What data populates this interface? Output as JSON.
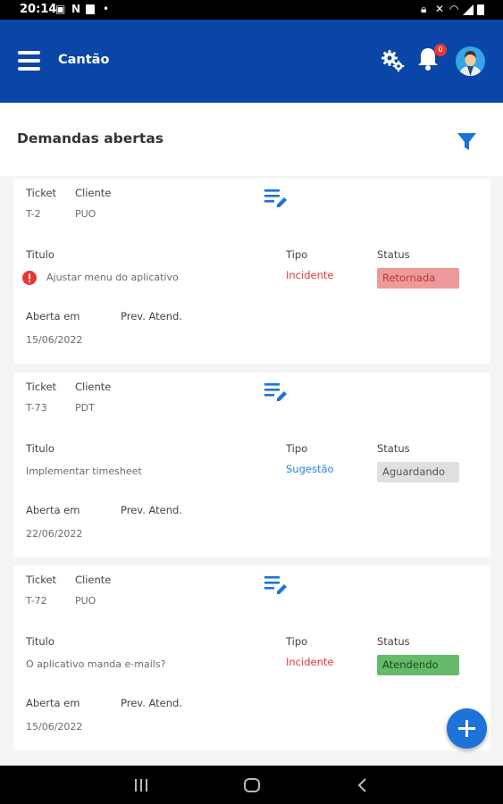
{
  "status_bar": {
    "time": "20:14",
    "n_glyph": "N"
  },
  "app_bar": {
    "title": "Cantão",
    "notification_count": "0"
  },
  "section": {
    "title": "Demandas abertas"
  },
  "labels": {
    "ticket": "Ticket",
    "cliente": "Cliente",
    "titulo": "Titulo",
    "tipo": "Tipo",
    "status": "Status",
    "aberta_em": "Aberta em",
    "prev_atend": "Prev. Atend."
  },
  "cards": [
    {
      "ticket": "T-2",
      "cliente": "PUO",
      "titulo": "Ajustar menu do aplicativo",
      "tipo": "Incidente",
      "status": "Retornada",
      "aberta_em": "15/06/2022",
      "prev_atend": "",
      "alert": true
    },
    {
      "ticket": "T-73",
      "cliente": "PDT",
      "titulo": "Implementar timesheet",
      "tipo": "Sugestão",
      "status": "Aguardando",
      "aberta_em": "22/06/2022",
      "prev_atend": "",
      "alert": false
    },
    {
      "ticket": "T-72",
      "cliente": "PUO",
      "titulo": "O aplicativo manda e-mails?",
      "tipo": "Incidente",
      "status": "Atendendo",
      "aberta_em": "15/06/2022",
      "prev_atend": "",
      "alert": false
    }
  ],
  "colors": {
    "app_bar": "#0a45a8",
    "accent": "#1e73d8",
    "tipo_incidente": "#e53935",
    "tipo_sugestao": "#2f86e0",
    "status_retornada_bg": "#ef9a9a",
    "status_retornada_fg": "#b23a3a",
    "status_aguardando_bg": "#e0e0e0",
    "status_aguardando_fg": "#555555",
    "status_atendendo_bg": "#66bb6a",
    "status_atendendo_fg": "#1e4d20"
  },
  "icons": {
    "menu": "hamburger-icon",
    "settings": "gear-icon",
    "notifications": "bell-icon",
    "filter": "filter-icon",
    "edit": "edit-note-icon",
    "alert": "alert-icon",
    "add": "plus-icon"
  }
}
